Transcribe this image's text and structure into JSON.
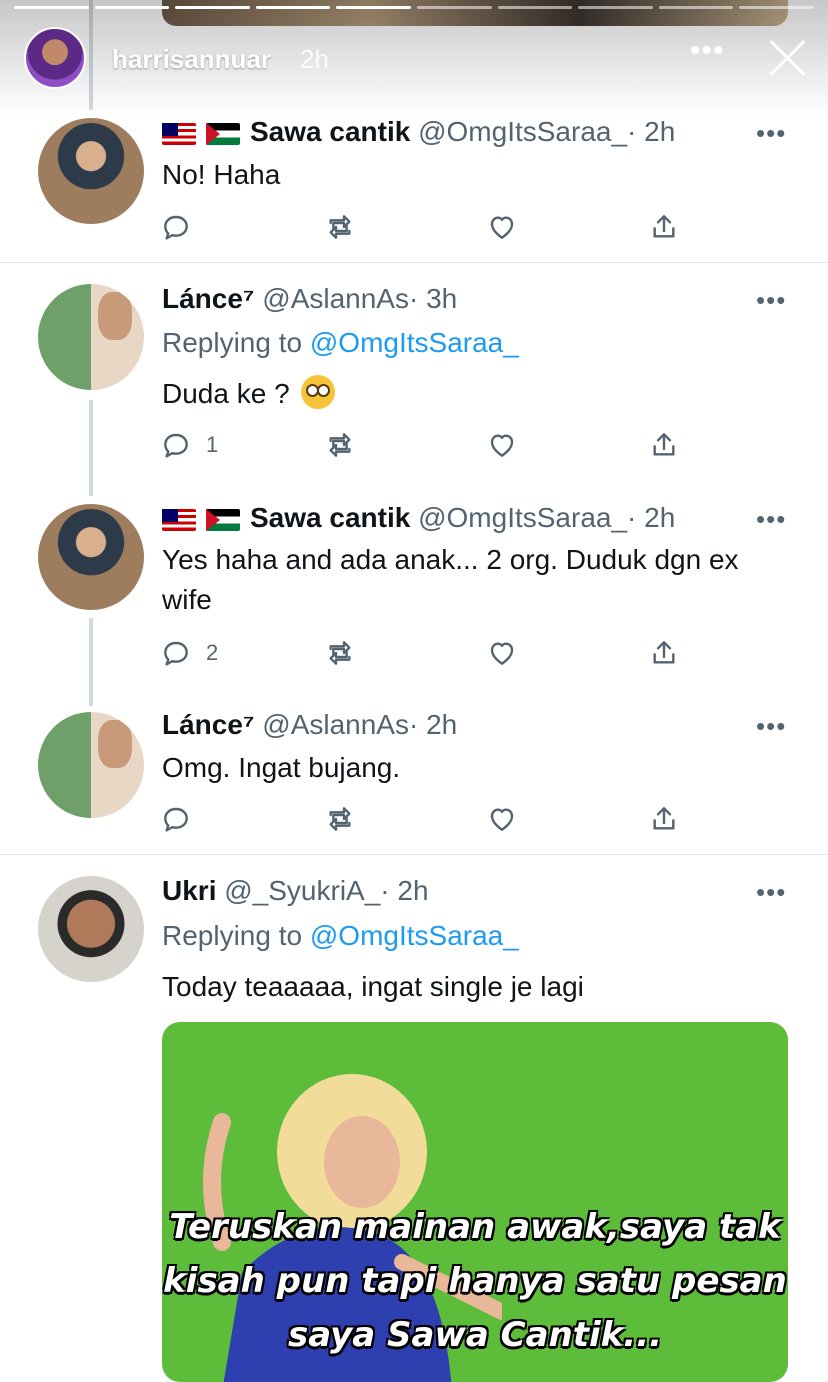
{
  "story": {
    "username": "harrisannuar",
    "time": "2h",
    "more": "•••"
  },
  "tweets": [
    {
      "name": "Sawa cantik",
      "handle": "@OmgItsSaraa_",
      "time": "· 2h",
      "text": "No! Haha",
      "reply_count": ""
    },
    {
      "name": "Lánce⁷",
      "handle": "@AslannAs",
      "time": "· 3h",
      "replying_label": "Replying to",
      "replying_mention": "@OmgItsSaraa_",
      "text": "Duda ke ?",
      "reply_count": "1"
    },
    {
      "name": "Sawa cantik",
      "handle": "@OmgItsSaraa_",
      "time": "· 2h",
      "text": "Yes haha and ada anak... 2 org. Duduk dgn ex wife",
      "reply_count": "2"
    },
    {
      "name": "Lánce⁷",
      "handle": "@AslannAs",
      "time": "· 2h",
      "text": "Omg. Ingat bujang.",
      "reply_count": ""
    },
    {
      "name": "Ukri",
      "handle": "@_SyukriA_",
      "time": "· 2h",
      "replying_label": "Replying to",
      "replying_mention": "@OmgItsSaraa_",
      "text": "Today teaaaaa, ingat single je lagi",
      "meme_caption": "Teruskan mainan awak,saya tak kisah pun tapi hanya satu pesan saya Sawa Cantik..."
    }
  ],
  "icons": {
    "reply": "reply-icon",
    "retweet": "retweet-icon",
    "like": "heart-icon",
    "share": "share-icon"
  },
  "colors": {
    "link": "#1d9bf0",
    "meta": "#536471",
    "meme_bg": "#5dbd3b"
  }
}
